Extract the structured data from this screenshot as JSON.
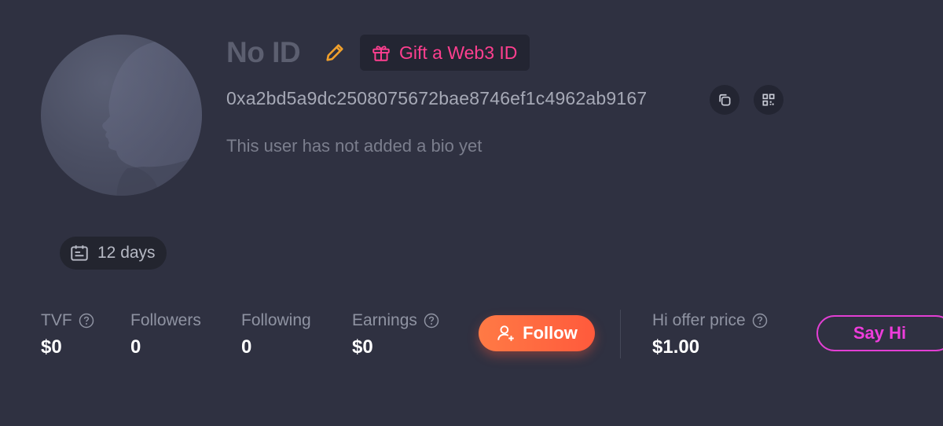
{
  "profile": {
    "name": "No ID",
    "gift_label": "Gift a Web3 ID",
    "address": "0xa2bd5a9dc2508075672bae8746ef1c4962ab9167",
    "bio": "This user has not added a bio yet",
    "age": "12 days"
  },
  "stats": {
    "tvf": {
      "label": "TVF",
      "value": "$0"
    },
    "followers": {
      "label": "Followers",
      "value": "0"
    },
    "following": {
      "label": "Following",
      "value": "0"
    },
    "earnings": {
      "label": "Earnings",
      "value": "$0"
    },
    "hi_offer": {
      "label": "Hi offer price",
      "value": "$1.00"
    }
  },
  "actions": {
    "follow_label": "Follow",
    "say_hi_label": "Say Hi"
  },
  "icons": {
    "edit": "pencil-icon",
    "gift": "gift-icon",
    "copy": "copy-icon",
    "qr": "qr-code-icon",
    "calendar": "calendar-icon",
    "help": "question-circle-icon",
    "follow": "user-plus-icon"
  },
  "colors": {
    "background": "#2f3141",
    "accent_pink": "#ff3f8f",
    "follow_orange": "#ff6a3f",
    "say_hi_magenta": "#e23fd3",
    "edit_orange": "#f0a02c"
  }
}
